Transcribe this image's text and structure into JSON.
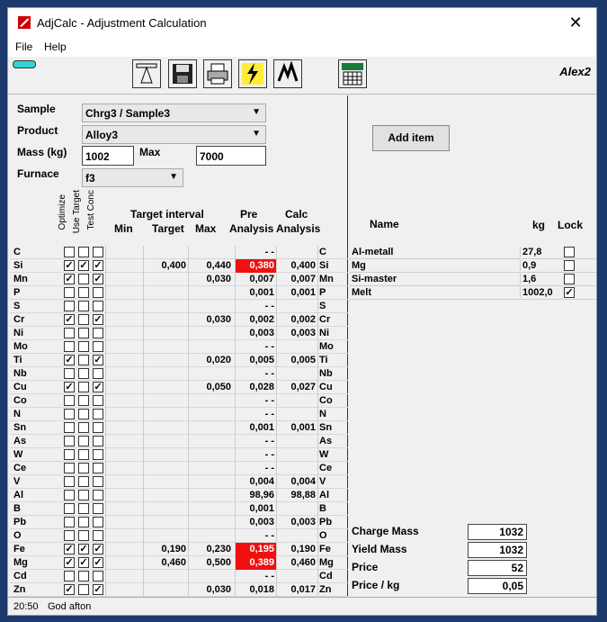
{
  "window": {
    "title": "AdjCalc - Adjustment Calculation",
    "close": "✕"
  },
  "menu": {
    "file": "File",
    "help": "Help"
  },
  "toolbar": {
    "user": "Alex2",
    "icons": [
      "scale-icon",
      "save-icon",
      "print-icon",
      "calculate-icon",
      "wave-icon",
      "keypad-icon"
    ]
  },
  "form": {
    "sample_label": "Sample",
    "sample_value": "Chrg3 / Sample3",
    "product_label": "Product",
    "product_value": "Alloy3",
    "mass_label": "Mass (kg)",
    "mass_value": "1002",
    "max_label": "Max",
    "max_value": "7000",
    "furnace_label": "Furnace",
    "furnace_value": "f3"
  },
  "headers": {
    "optimize": "Optimize",
    "use_target": "Use Target",
    "test_conc": "Test Conc",
    "target_interval": "Target interval",
    "min": "Min",
    "target": "Target",
    "max": "Max",
    "pre1": "Pre",
    "pre2": "Analysis",
    "calc1": "Calc",
    "calc2": "Analysis"
  },
  "elements": [
    {
      "el": "C",
      "opt": 0,
      "use": 0,
      "test": 0,
      "target": "",
      "max": "",
      "pre": "- -",
      "calc": "",
      "red": 0
    },
    {
      "el": "Si",
      "opt": 1,
      "use": 1,
      "test": 1,
      "target": "0,400",
      "max": "0,440",
      "pre": "0,380",
      "calc": "0,400",
      "red": 1
    },
    {
      "el": "Mn",
      "opt": 1,
      "use": 0,
      "test": 1,
      "target": "",
      "max": "0,030",
      "pre": "0,007",
      "calc": "0,007",
      "red": 0
    },
    {
      "el": "P",
      "opt": 0,
      "use": 0,
      "test": 0,
      "target": "",
      "max": "",
      "pre": "0,001",
      "calc": "0,001",
      "red": 0
    },
    {
      "el": "S",
      "opt": 0,
      "use": 0,
      "test": 0,
      "target": "",
      "max": "",
      "pre": "- -",
      "calc": "",
      "red": 0
    },
    {
      "el": "Cr",
      "opt": 1,
      "use": 0,
      "test": 1,
      "target": "",
      "max": "0,030",
      "pre": "0,002",
      "calc": "0,002",
      "red": 0
    },
    {
      "el": "Ni",
      "opt": 0,
      "use": 0,
      "test": 0,
      "target": "",
      "max": "",
      "pre": "0,003",
      "calc": "0,003",
      "red": 0
    },
    {
      "el": "Mo",
      "opt": 0,
      "use": 0,
      "test": 0,
      "target": "",
      "max": "",
      "pre": "- -",
      "calc": "",
      "red": 0
    },
    {
      "el": "Ti",
      "opt": 1,
      "use": 0,
      "test": 1,
      "target": "",
      "max": "0,020",
      "pre": "0,005",
      "calc": "0,005",
      "red": 0
    },
    {
      "el": "Nb",
      "opt": 0,
      "use": 0,
      "test": 0,
      "target": "",
      "max": "",
      "pre": "- -",
      "calc": "",
      "red": 0
    },
    {
      "el": "Cu",
      "opt": 1,
      "use": 0,
      "test": 1,
      "target": "",
      "max": "0,050",
      "pre": "0,028",
      "calc": "0,027",
      "red": 0
    },
    {
      "el": "Co",
      "opt": 0,
      "use": 0,
      "test": 0,
      "target": "",
      "max": "",
      "pre": "- -",
      "calc": "",
      "red": 0
    },
    {
      "el": "N",
      "opt": 0,
      "use": 0,
      "test": 0,
      "target": "",
      "max": "",
      "pre": "- -",
      "calc": "",
      "red": 0
    },
    {
      "el": "Sn",
      "opt": 0,
      "use": 0,
      "test": 0,
      "target": "",
      "max": "",
      "pre": "0,001",
      "calc": "0,001",
      "red": 0
    },
    {
      "el": "As",
      "opt": 0,
      "use": 0,
      "test": 0,
      "target": "",
      "max": "",
      "pre": "- -",
      "calc": "",
      "red": 0
    },
    {
      "el": "W",
      "opt": 0,
      "use": 0,
      "test": 0,
      "target": "",
      "max": "",
      "pre": "- -",
      "calc": "",
      "red": 0
    },
    {
      "el": "Ce",
      "opt": 0,
      "use": 0,
      "test": 0,
      "target": "",
      "max": "",
      "pre": "- -",
      "calc": "",
      "red": 0
    },
    {
      "el": "V",
      "opt": 0,
      "use": 0,
      "test": 0,
      "target": "",
      "max": "",
      "pre": "0,004",
      "calc": "0,004",
      "red": 0
    },
    {
      "el": "Al",
      "opt": 0,
      "use": 0,
      "test": 0,
      "target": "",
      "max": "",
      "pre": "98,96",
      "calc": "98,88",
      "red": 0
    },
    {
      "el": "B",
      "opt": 0,
      "use": 0,
      "test": 0,
      "target": "",
      "max": "",
      "pre": "0,001",
      "calc": "",
      "red": 0
    },
    {
      "el": "Pb",
      "opt": 0,
      "use": 0,
      "test": 0,
      "target": "",
      "max": "",
      "pre": "0,003",
      "calc": "0,003",
      "red": 0
    },
    {
      "el": "O",
      "opt": 0,
      "use": 0,
      "test": 0,
      "target": "",
      "max": "",
      "pre": "- -",
      "calc": "",
      "red": 0
    },
    {
      "el": "Fe",
      "opt": 1,
      "use": 1,
      "test": 1,
      "target": "0,190",
      "max": "0,230",
      "pre": "0,195",
      "calc": "0,190",
      "red": 1
    },
    {
      "el": "Mg",
      "opt": 1,
      "use": 1,
      "test": 1,
      "target": "0,460",
      "max": "0,500",
      "pre": "0,389",
      "calc": "0,460",
      "red": 1
    },
    {
      "el": "Cd",
      "opt": 0,
      "use": 0,
      "test": 0,
      "target": "",
      "max": "",
      "pre": "- -",
      "calc": "",
      "red": 0
    },
    {
      "el": "Zn",
      "opt": 1,
      "use": 0,
      "test": 1,
      "target": "",
      "max": "0,030",
      "pre": "0,018",
      "calc": "0,017",
      "red": 0
    }
  ],
  "right": {
    "add_item": "Add item",
    "name": "Name",
    "kg": "kg",
    "lock": "Lock",
    "items": [
      {
        "name": "Al-metall",
        "kg": "27,8",
        "lock": 0
      },
      {
        "name": "Mg",
        "kg": "0,9",
        "lock": 0
      },
      {
        "name": "Si-master",
        "kg": "1,6",
        "lock": 0
      },
      {
        "name": "Melt",
        "kg": "1002,0",
        "lock": 1
      }
    ],
    "summary": [
      {
        "label": "Charge Mass",
        "value": "1032"
      },
      {
        "label": "Yield Mass",
        "value": "1032"
      },
      {
        "label": "Price",
        "value": "52"
      },
      {
        "label": "Price / kg",
        "value": "0,05"
      }
    ]
  },
  "status": {
    "time": "20:50",
    "message": "God afton"
  }
}
